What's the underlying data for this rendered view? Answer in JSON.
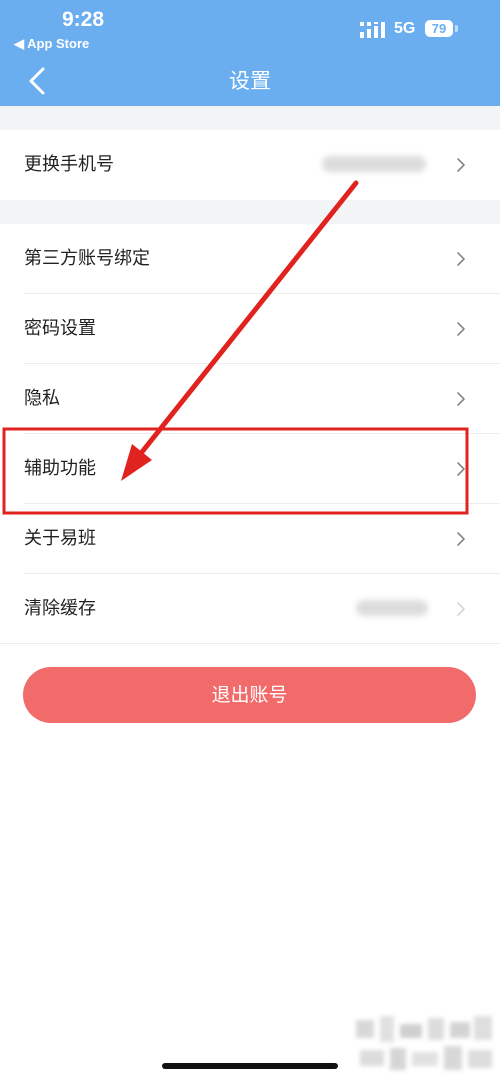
{
  "status_bar": {
    "time": "9:28",
    "back_app": "◀ App Store",
    "network": "5G",
    "battery": "79"
  },
  "header": {
    "title": "设置",
    "back_icon": "chevron-left-icon"
  },
  "groups": [
    {
      "items": [
        {
          "label": "更换手机号",
          "value_hidden": true
        }
      ]
    },
    {
      "items": [
        {
          "label": "第三方账号绑定"
        },
        {
          "label": "密码设置"
        },
        {
          "label": "隐私"
        },
        {
          "label": "辅助功能",
          "highlighted": true
        },
        {
          "label": "关于易班"
        },
        {
          "label": "清除缓存",
          "value_hidden": true
        }
      ]
    }
  ],
  "logout_button": "退出账号",
  "colors": {
    "header_bg": "#6aaef0",
    "logout_bg": "#f26b6b",
    "annotation": "#e0231f",
    "group_gap": "#f3f4f6"
  }
}
